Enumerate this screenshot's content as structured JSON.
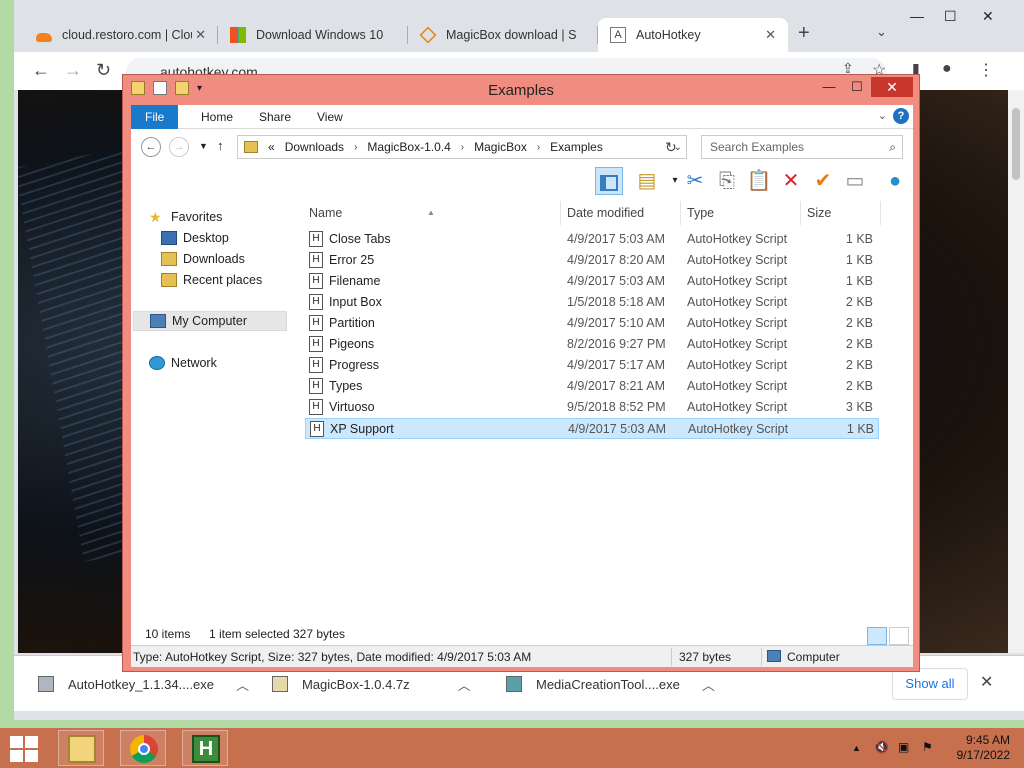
{
  "browser": {
    "tabs": [
      {
        "label": "cloud.restoro.com | Clou",
        "icon": "cloud-icon",
        "color": "#f48120"
      },
      {
        "label": "Download Windows 10",
        "icon": "windows-logo-icon",
        "color": "#0078d7"
      },
      {
        "label": "MagicBox download | So",
        "icon": "diamond-icon",
        "color": "#e8831a"
      },
      {
        "label": "AutoHotkey",
        "icon": "letter-a-icon",
        "color": "#555555"
      }
    ],
    "close_glyph": "✕",
    "new_tab_glyph": "+",
    "address": "autohotkey.com"
  },
  "explorer": {
    "title": "Examples",
    "ribbon_tabs": [
      "File",
      "Home",
      "Share",
      "View"
    ],
    "breadcrumb": {
      "prefix": "«",
      "items": [
        "Downloads",
        "MagicBox-1.0.4",
        "MagicBox",
        "Examples"
      ]
    },
    "search_placeholder": "Search Examples",
    "nav": {
      "favorites": "Favorites",
      "desktop": "Desktop",
      "downloads": "Downloads",
      "recent": "Recent places",
      "computer": "My Computer",
      "network": "Network"
    },
    "columns": [
      "Name",
      "Date modified",
      "Type",
      "Size"
    ],
    "files": [
      {
        "name": "Close Tabs",
        "date": "4/9/2017 5:03 AM",
        "type": "AutoHotkey Script",
        "size": "1 KB"
      },
      {
        "name": "Error 25",
        "date": "4/9/2017 8:20 AM",
        "type": "AutoHotkey Script",
        "size": "1 KB"
      },
      {
        "name": "Filename",
        "date": "4/9/2017 5:03 AM",
        "type": "AutoHotkey Script",
        "size": "1 KB"
      },
      {
        "name": "Input Box",
        "date": "1/5/2018 5:18 AM",
        "type": "AutoHotkey Script",
        "size": "2 KB"
      },
      {
        "name": "Partition",
        "date": "4/9/2017 5:10 AM",
        "type": "AutoHotkey Script",
        "size": "2 KB"
      },
      {
        "name": "Pigeons",
        "date": "8/2/2016 9:27 PM",
        "type": "AutoHotkey Script",
        "size": "2 KB"
      },
      {
        "name": "Progress",
        "date": "4/9/2017 5:17 AM",
        "type": "AutoHotkey Script",
        "size": "2 KB"
      },
      {
        "name": "Types",
        "date": "4/9/2017 8:21 AM",
        "type": "AutoHotkey Script",
        "size": "2 KB"
      },
      {
        "name": "Virtuoso",
        "date": "9/5/2018 8:52 PM",
        "type": "AutoHotkey Script",
        "size": "3 KB"
      },
      {
        "name": "XP Support",
        "date": "4/9/2017 5:03 AM",
        "type": "AutoHotkey Script",
        "size": "1 KB",
        "selected": true
      }
    ],
    "status": {
      "items": "10 items",
      "selected": "1 item selected",
      "sel_size": "327 bytes"
    },
    "details": {
      "text": "Type: AutoHotkey Script, Size: 327 bytes, Date modified: 4/9/2017 5:03 AM",
      "size": "327 bytes",
      "location": "Computer"
    }
  },
  "downloads": {
    "items": [
      {
        "name": "AutoHotkey_1.1.34....exe"
      },
      {
        "name": "MagicBox-1.0.4.7z"
      },
      {
        "name": "MediaCreationTool....exe"
      }
    ],
    "show_all": "Show all"
  },
  "taskbar": {
    "time": "9:45 AM",
    "date": "9/17/2022",
    "ahk_letter": "H"
  },
  "colors": {
    "explorer_frame": "#f08c80",
    "close_button": "#c7372c",
    "ribbon_file": "#1979ca",
    "selection": "#cce8ff",
    "taskbar": "#c6704e",
    "desktop": "#b3d9a5"
  }
}
